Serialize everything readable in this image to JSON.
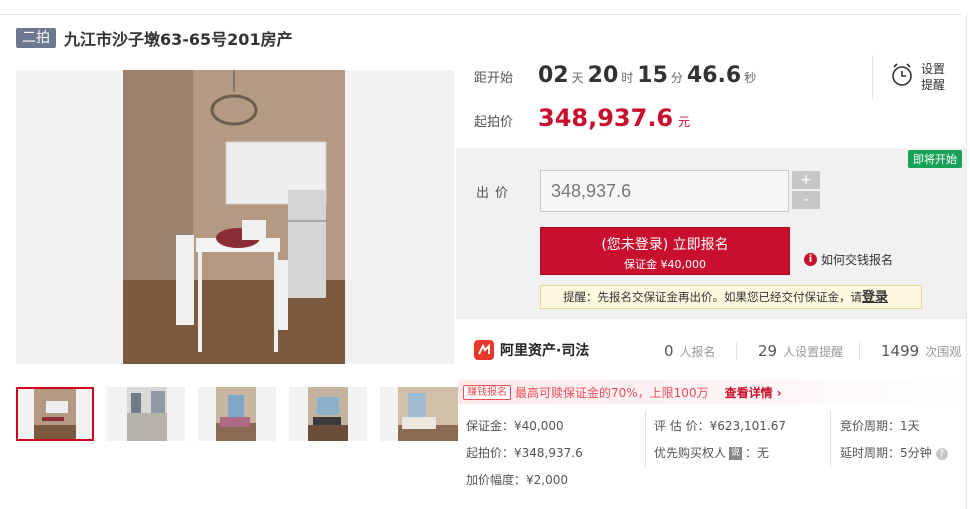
{
  "header": {
    "tag": "二拍",
    "title": "九江市沙子墩63-65号201房产"
  },
  "countdown": {
    "label": "距开始",
    "days": "02",
    "days_unit": "天",
    "hours": "20",
    "hours_unit": "时",
    "minutes": "15",
    "minutes_unit": "分",
    "seconds": "46.6",
    "seconds_unit": "秒"
  },
  "start_price": {
    "label": "起拍价",
    "value": "348,937.6",
    "unit": "元"
  },
  "reminder": {
    "label_line1": "设置",
    "label_line2": "提醒"
  },
  "bid": {
    "status_badge": "即将开始",
    "label": "出价",
    "input_value": "348,937.6",
    "plus": "+",
    "minus": "-",
    "signup_main": "(您未登录) 立即报名",
    "signup_sub": "保证金 ¥40,000",
    "howto": "如何交钱报名",
    "tip_prefix": "提醒：先报名交保证金再出价。如果您已经交付保证金，请",
    "tip_login": "登录"
  },
  "stats": {
    "brand": "阿里资产·司法",
    "signups_num": "0",
    "signups_label": "人报名",
    "reminders_num": "29",
    "reminders_label": "人设置提醒",
    "views_num": "1499",
    "views_label": "次围观"
  },
  "promo": {
    "tag": "赚钱报名",
    "text": "最高可赎保证金的70%，上限100万",
    "link": "查看详情 ›"
  },
  "details": {
    "deposit": "保证金：¥40,000",
    "start_price": "起拍价：¥348,937.6",
    "increment": "加价幅度：¥2,000",
    "appraisal": "评 估 价：¥623,101.67",
    "priority_label": "优先购买权人",
    "priority_icon": "说",
    "priority_value": "：无",
    "cycle": "竞价周期：1天",
    "delay": "延时周期：5分钟"
  },
  "colors": {
    "accent": "#c8102e",
    "tag_bg": "#6b7890",
    "badge_green": "#19a35a"
  }
}
